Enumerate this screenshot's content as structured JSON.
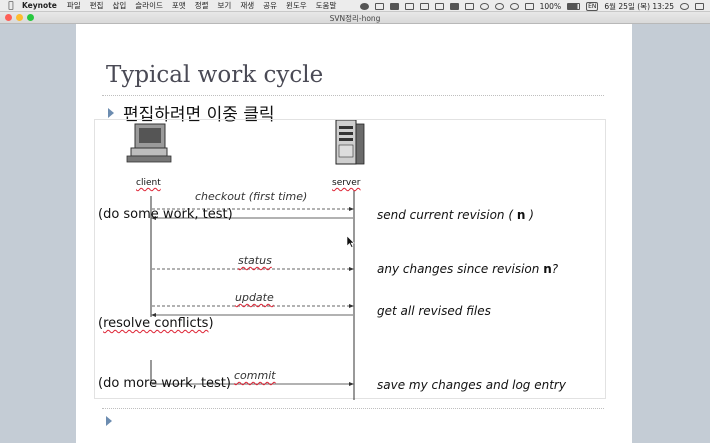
{
  "menubar": {
    "apple_icon": "apple-icon",
    "app_name": "Keynote",
    "menus": [
      "파일",
      "편집",
      "삽입",
      "슬라이드",
      "포맷",
      "정렬",
      "보기",
      "재생",
      "공유",
      "윈도우",
      "도움말"
    ],
    "status": {
      "battery": "100%",
      "input_source": "EN",
      "date_time": "6월 25일 (목)  13:25"
    }
  },
  "window": {
    "title": "SVN정리-hong",
    "traffic_lights": {
      "close": "#fe5f57",
      "minimize": "#febc2e",
      "zoom": "#28c840"
    }
  },
  "slide": {
    "title": "Typical work cycle",
    "body_hint": "편집하려면 이중 클릭",
    "bullet_color": "#6c8cb0",
    "diagram": {
      "client_label": "client",
      "server_label": "server",
      "messages": {
        "checkout": "checkout (first time)",
        "status": "status",
        "update": "update",
        "commit": "commit"
      },
      "notes": {
        "send_revision_pre": "send current revision ( ",
        "send_revision_n": "n",
        "send_revision_post": " )",
        "any_changes_pre": "any changes since revision ",
        "any_changes_n": "n",
        "any_changes_post": "?",
        "get_files": "get all revised files",
        "save_changes": "save my changes and log entry"
      },
      "actions": {
        "do_work": "(do some work, test)",
        "resolve_pre": "(",
        "resolve_word": "resolve conflicts",
        "resolve_post": ")",
        "do_more": "(do more work, test)"
      }
    }
  }
}
